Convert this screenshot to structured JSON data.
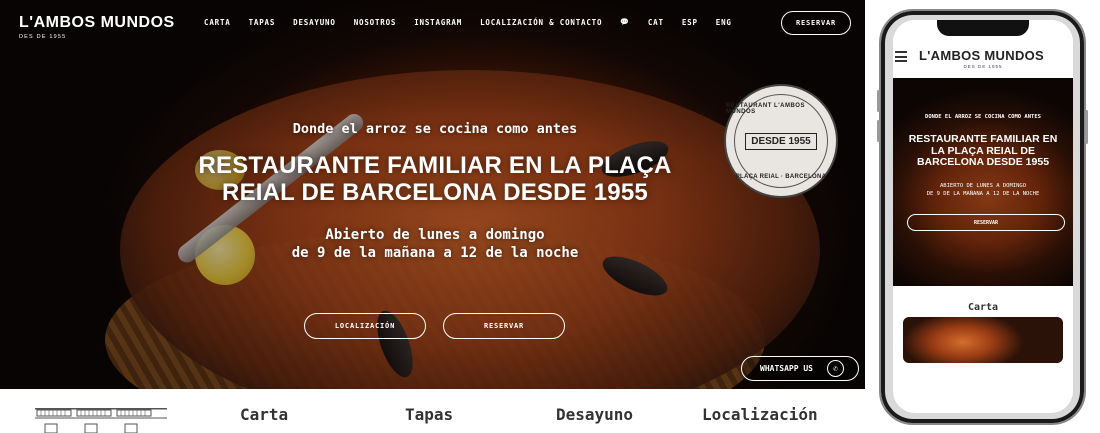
{
  "desktop": {
    "brand": {
      "name": "L'AMBOS MUNDOS",
      "since": "DES DE 1955"
    },
    "nav": {
      "items": [
        "CARTA",
        "TAPAS",
        "DESAYUNO",
        "NOSOTROS",
        "INSTAGRAM",
        "LOCALIZACIÓN & CONTACTO",
        "💬",
        "CAT",
        "ESP",
        "ENG"
      ],
      "reservar": "RESERVAR"
    },
    "seal": {
      "top": "RESTAURANT L'AMBOS MUNDOS",
      "year": "DESDE 1955",
      "bottom": "PLAÇA REIAL · BARCELONA"
    },
    "hero": {
      "tagline": "Donde el arroz se cocina como antes",
      "headline_line1": "RESTAURANTE FAMILIAR EN LA PLAÇA",
      "headline_line2": "REIAL DE BARCELONA DESDE 1955",
      "hours_line1": "Abierto de lunes a domingo",
      "hours_line2": "de 9 de la mañana a 12 de la noche",
      "localizacion": "LOCALIZACIÓN",
      "reservar": "RESERVAR"
    },
    "whatsapp": "WHATSAPP US",
    "categories": [
      "Carta",
      "Tapas",
      "Desayuno",
      "Localización"
    ]
  },
  "mobile": {
    "brand": {
      "name": "L'AMBOS MUNDOS",
      "since": "DES DE 1955"
    },
    "hero": {
      "tagline": "DONDE EL ARROZ SE COCINA COMO ANTES",
      "headline_line1": "RESTAURANTE FAMILIAR EN",
      "headline_line2": "LA PLAÇA REIAL DE",
      "headline_line3": "BARCELONA DESDE 1955",
      "hours_line1": "ABIERTO DE LUNES A DOMINGO",
      "hours_line2": "DE 9 DE LA MAÑANA A 12 DE LA NOCHE",
      "reservar": "RESERVAR"
    },
    "section_title": "Carta"
  },
  "colors": {
    "accent": "#ffffff",
    "hero_dark": "#1a0a05",
    "paella": "#b8531c"
  }
}
